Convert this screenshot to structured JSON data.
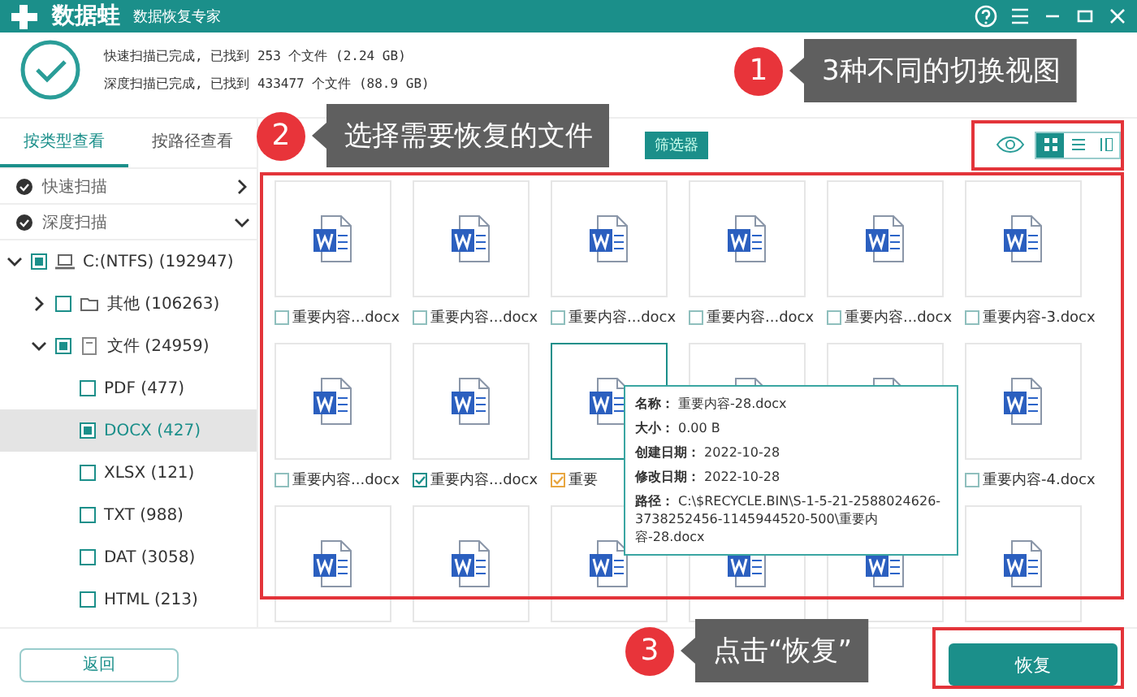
{
  "title_bar": {
    "app_name": "数据蛙",
    "subtitle": "数据恢复专家"
  },
  "scan_summary": [
    "快速扫描已完成, 已找到 253 个文件 (2.24 GB)",
    "深度扫描已完成, 已找到 433477 个文件 (88.9 GB)"
  ],
  "view_tabs": [
    {
      "label": "按类型查看",
      "selected": true
    },
    {
      "label": "按路径查看",
      "selected": false
    }
  ],
  "filter_button": {
    "label": "筛选器"
  },
  "view_modes": [
    {
      "kind": "grid",
      "selected": true
    },
    {
      "kind": "list",
      "selected": false
    },
    {
      "kind": "detail",
      "selected": false
    }
  ],
  "scan_sections": [
    {
      "label": "快速扫描",
      "expanded": false
    },
    {
      "label": "深度扫描",
      "expanded": true
    }
  ],
  "tree": [
    {
      "label": "C:(NTFS) (192947)",
      "kind": "drive",
      "expanded": true,
      "checked": true,
      "selected": false,
      "children": [
        {
          "label": "其他 (106263)",
          "kind": "folder",
          "expanded": false,
          "checked": false,
          "selected": false
        },
        {
          "label": "文件 (24959)",
          "kind": "category",
          "expanded": true,
          "checked": true,
          "selected": false,
          "children": [
            {
              "label": "PDF (477)",
              "checked": false,
              "selected": false
            },
            {
              "label": "DOCX (427)",
              "checked": true,
              "selected": true
            },
            {
              "label": "XLSX (121)",
              "checked": false,
              "selected": false
            },
            {
              "label": "TXT (988)",
              "checked": false,
              "selected": false
            },
            {
              "label": "DAT (3058)",
              "checked": false,
              "selected": false
            },
            {
              "label": "HTML (213)",
              "checked": false,
              "selected": false
            }
          ]
        }
      ]
    }
  ],
  "files": [
    {
      "name": "重要内容...docx",
      "checked": false,
      "hovered": false
    },
    {
      "name": "重要内容...docx",
      "checked": false,
      "hovered": false
    },
    {
      "name": "重要内容...docx",
      "checked": false,
      "hovered": false
    },
    {
      "name": "重要内容...docx",
      "checked": false,
      "hovered": false
    },
    {
      "name": "重要内容...docx",
      "checked": false,
      "hovered": false
    },
    {
      "name": "重要内容-3.docx",
      "checked": false,
      "hovered": false
    },
    {
      "name": "重要内容...docx",
      "checked": false,
      "hovered": false
    },
    {
      "name": "重要内容...docx",
      "checked": true,
      "hovered": false
    },
    {
      "name": "重要",
      "checked": true,
      "hovered": true
    },
    {
      "hovered": false
    },
    {
      "hovered": false
    },
    {
      "name": "重要内容-4.docx",
      "checked": false,
      "hovered": false
    },
    {
      "hovered": false
    },
    {
      "hovered": false
    },
    {
      "hovered": false
    },
    {
      "hovered": false
    },
    {
      "hovered": false
    },
    {
      "hovered": false
    }
  ],
  "tooltip": [
    {
      "label": "名称：",
      "value": "重要内容-28.docx"
    },
    {
      "label": "大小：",
      "value": "0.00 B"
    },
    {
      "label": "创建日期：",
      "value": "2022-10-28"
    },
    {
      "label": "修改日期：",
      "value": "2022-10-28"
    },
    {
      "label": "路径：",
      "value": "C:\\$RECYCLE.BIN\\S-1-5-21-2588024626-3738252456-1145944520-500\\重要内容-28.docx"
    }
  ],
  "back_button": {
    "label": "返回"
  },
  "recover_button": {
    "label": "恢复"
  },
  "callouts": [
    {
      "number": "1",
      "text": "3种不同的切换视图"
    },
    {
      "number": "2",
      "text": "选择需要恢复的文件"
    },
    {
      "number": "3",
      "text": "点击“恢复”"
    }
  ]
}
